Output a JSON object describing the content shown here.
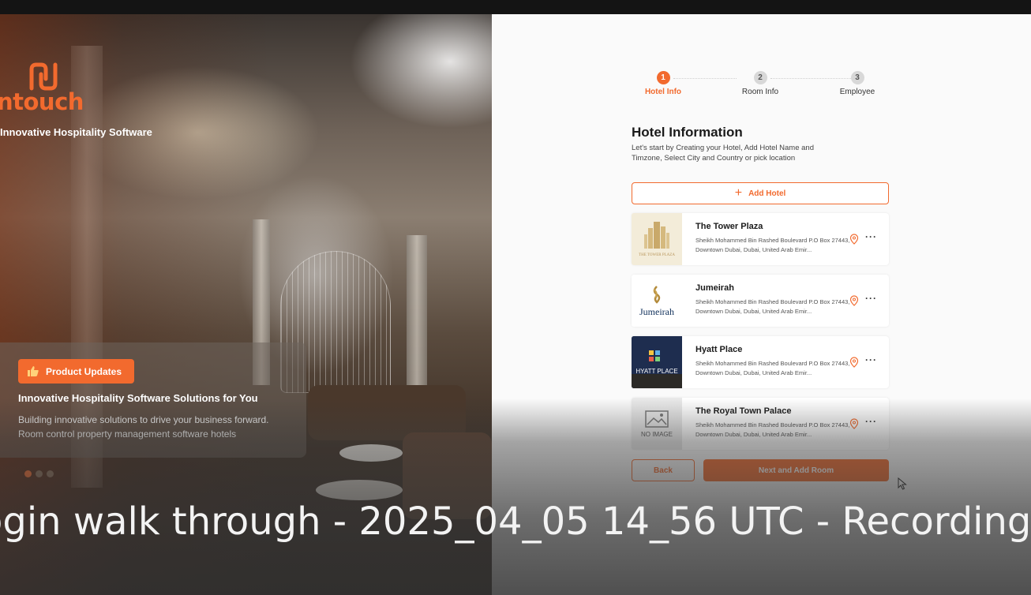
{
  "brand": {
    "word": "ntouch",
    "tagline": "Innovative Hospitality Software"
  },
  "promo": {
    "badge_label": "Product Updates",
    "badge_icon": "thumbs-up-icon",
    "title": "Innovative Hospitality Software Solutions for You",
    "line1": "Building innovative solutions to drive your business forward.",
    "line2": "Room control  property management software hotels",
    "carousel_count": 3,
    "carousel_active": 0
  },
  "stepper": {
    "steps": [
      {
        "num": "1",
        "label": "Hotel Info",
        "active": true
      },
      {
        "num": "2",
        "label": "Room Info",
        "active": false
      },
      {
        "num": "3",
        "label": "Employee",
        "active": false
      }
    ]
  },
  "form": {
    "title": "Hotel Information",
    "subtitle": "Let's start by Creating your Hotel, Add Hotel Name and Timzone, Select City and Country or pick location",
    "add_label": "Add Hotel"
  },
  "hotels": [
    {
      "name": "The Tower Plaza",
      "address": "Sheikh Mohammed Bin Rashed Boulevard P.O Box 27443, Downtown Dubai, Dubai, United Arab Emir...",
      "thumb_text": "THE TOWER PLAZA"
    },
    {
      "name": "Jumeirah",
      "address": "Sheikh Mohammed Bin Rashed Boulevard P.O Box 27443, Downtown Dubai, Dubai, United Arab Emir...",
      "thumb_text": "Jumeirah"
    },
    {
      "name": "Hyatt Place",
      "address": "Sheikh Mohammed Bin Rashed Boulevard P.O Box 27443, Downtown Dubai, Dubai, United Arab Emir...",
      "thumb_text": "HYATT PLACE"
    },
    {
      "name": "The Royal Town Palace",
      "address": "Sheikh Mohammed Bin Rashed Boulevard P.O Box 27443, Downtown Dubai, Dubai, United Arab Emir...",
      "thumb_text": "NO IMAGE"
    }
  ],
  "actions": {
    "back_label": "Back",
    "next_label": "Next and Add Room"
  },
  "video": {
    "title": "ogin walk through - 2025_04_05 14_56 UTC - Recording"
  },
  "colors": {
    "accent": "#f26a2e"
  }
}
